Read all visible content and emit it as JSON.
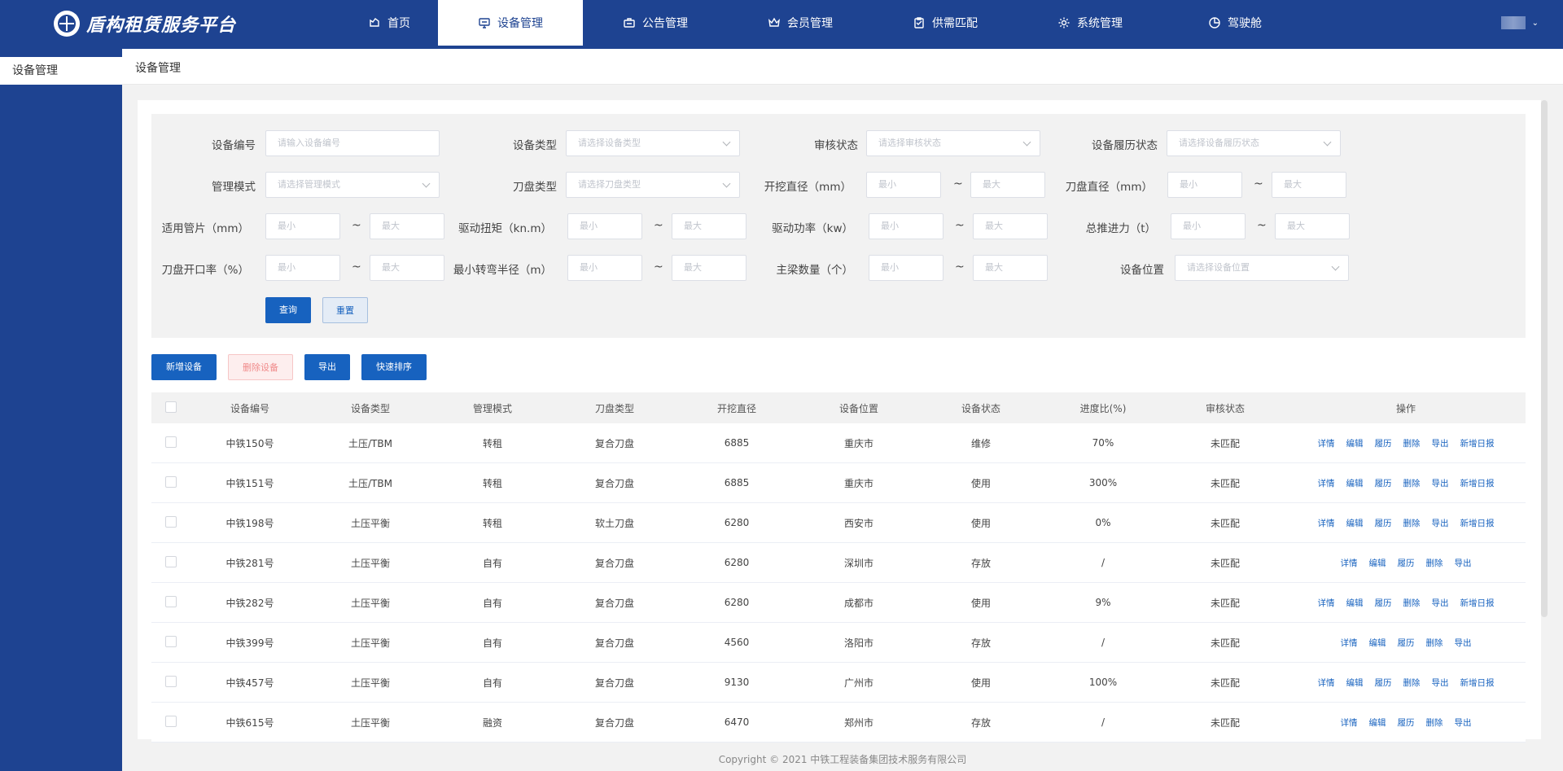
{
  "app": {
    "title": "盾构租赁服务平台"
  },
  "nav": [
    {
      "label": "首页",
      "icon": "home-icon",
      "width": 120,
      "active": false
    },
    {
      "label": "设备管理",
      "icon": "monitor-icon",
      "width": 178,
      "active": true
    },
    {
      "label": "公告管理",
      "icon": "briefcase-icon",
      "width": 178,
      "active": false
    },
    {
      "label": "会员管理",
      "icon": "crown-icon",
      "width": 178,
      "active": false
    },
    {
      "label": "供需匹配",
      "icon": "clipboard-icon",
      "width": 178,
      "active": false
    },
    {
      "label": "系统管理",
      "icon": "gear-icon",
      "width": 178,
      "active": false
    },
    {
      "label": "驾驶舱",
      "icon": "pie-chart-icon",
      "width": 178,
      "active": false
    }
  ],
  "sidebar": {
    "items": [
      {
        "label": "设备管理"
      }
    ]
  },
  "breadcrumb": {
    "current": "设备管理"
  },
  "filter": {
    "device_no": {
      "label": "设备编号",
      "placeholder": "请输入设备编号"
    },
    "device_type": {
      "label": "设备类型",
      "placeholder": "请选择设备类型"
    },
    "audit_status": {
      "label": "审核状态",
      "placeholder": "请选择审核状态"
    },
    "history_status": {
      "label": "设备履历状态",
      "placeholder": "请选择设备履历状态"
    },
    "mgmt_mode": {
      "label": "管理模式",
      "placeholder": "请选择管理模式"
    },
    "cutter_type": {
      "label": "刀盘类型",
      "placeholder": "请选择刀盘类型"
    },
    "excavation_dia": {
      "label": "开挖直径（mm）"
    },
    "cutter_dia": {
      "label": "刀盘直径（mm）"
    },
    "segment": {
      "label": "适用管片（mm）"
    },
    "torque": {
      "label": "驱动扭矩（kn.m）"
    },
    "power": {
      "label": "驱动功率（kw）"
    },
    "thrust": {
      "label": "总推进力（t）"
    },
    "opening_rate": {
      "label": "刀盘开口率（%）"
    },
    "turn_radius": {
      "label": "最小转弯半径（m）"
    },
    "beam_count": {
      "label": "主梁数量（个）"
    },
    "location": {
      "label": "设备位置",
      "placeholder": "请选择设备位置"
    },
    "min_placeholder": "最小",
    "max_placeholder": "最大",
    "tilde": "~",
    "query_label": "查询",
    "reset_label": "重置"
  },
  "toolbar": {
    "add_label": "新增设备",
    "delete_label": "删除设备",
    "export_label": "导出",
    "sort_label": "快速排序"
  },
  "table": {
    "columns": [
      "设备编号",
      "设备类型",
      "管理模式",
      "刀盘类型",
      "开挖直径",
      "设备位置",
      "设备状态",
      "进度比(%)",
      "审核状态",
      "操作"
    ],
    "rows": [
      {
        "no": "中铁150号",
        "type": "土压/TBM",
        "mode": "转租",
        "cutter": "复合刀盘",
        "dia": "6885",
        "loc": "重庆市",
        "status": "维修",
        "progress": "70%",
        "audit": "未匹配",
        "ops": [
          "详情",
          "编辑",
          "履历",
          "删除",
          "导出",
          "新增日报"
        ]
      },
      {
        "no": "中铁151号",
        "type": "土压/TBM",
        "mode": "转租",
        "cutter": "复合刀盘",
        "dia": "6885",
        "loc": "重庆市",
        "status": "使用",
        "progress": "300%",
        "audit": "未匹配",
        "ops": [
          "详情",
          "编辑",
          "履历",
          "删除",
          "导出",
          "新增日报"
        ]
      },
      {
        "no": "中铁198号",
        "type": "土压平衡",
        "mode": "转租",
        "cutter": "软土刀盘",
        "dia": "6280",
        "loc": "西安市",
        "status": "使用",
        "progress": "0%",
        "audit": "未匹配",
        "ops": [
          "详情",
          "编辑",
          "履历",
          "删除",
          "导出",
          "新增日报"
        ]
      },
      {
        "no": "中铁281号",
        "type": "土压平衡",
        "mode": "自有",
        "cutter": "复合刀盘",
        "dia": "6280",
        "loc": "深圳市",
        "status": "存放",
        "progress": "/",
        "audit": "未匹配",
        "ops": [
          "详情",
          "编辑",
          "履历",
          "删除",
          "导出"
        ]
      },
      {
        "no": "中铁282号",
        "type": "土压平衡",
        "mode": "自有",
        "cutter": "复合刀盘",
        "dia": "6280",
        "loc": "成都市",
        "status": "使用",
        "progress": "9%",
        "audit": "未匹配",
        "ops": [
          "详情",
          "编辑",
          "履历",
          "删除",
          "导出",
          "新增日报"
        ]
      },
      {
        "no": "中铁399号",
        "type": "土压平衡",
        "mode": "自有",
        "cutter": "复合刀盘",
        "dia": "4560",
        "loc": "洛阳市",
        "status": "存放",
        "progress": "/",
        "audit": "未匹配",
        "ops": [
          "详情",
          "编辑",
          "履历",
          "删除",
          "导出"
        ]
      },
      {
        "no": "中铁457号",
        "type": "土压平衡",
        "mode": "自有",
        "cutter": "复合刀盘",
        "dia": "9130",
        "loc": "广州市",
        "status": "使用",
        "progress": "100%",
        "audit": "未匹配",
        "ops": [
          "详情",
          "编辑",
          "履历",
          "删除",
          "导出",
          "新增日报"
        ]
      },
      {
        "no": "中铁615号",
        "type": "土压平衡",
        "mode": "融资",
        "cutter": "复合刀盘",
        "dia": "6470",
        "loc": "郑州市",
        "status": "存放",
        "progress": "/",
        "audit": "未匹配",
        "ops": [
          "详情",
          "编辑",
          "履历",
          "删除",
          "导出"
        ]
      }
    ]
  },
  "footer": {
    "copyright": "Copyright © 2021 中铁工程装备集团技术服务有限公司"
  }
}
